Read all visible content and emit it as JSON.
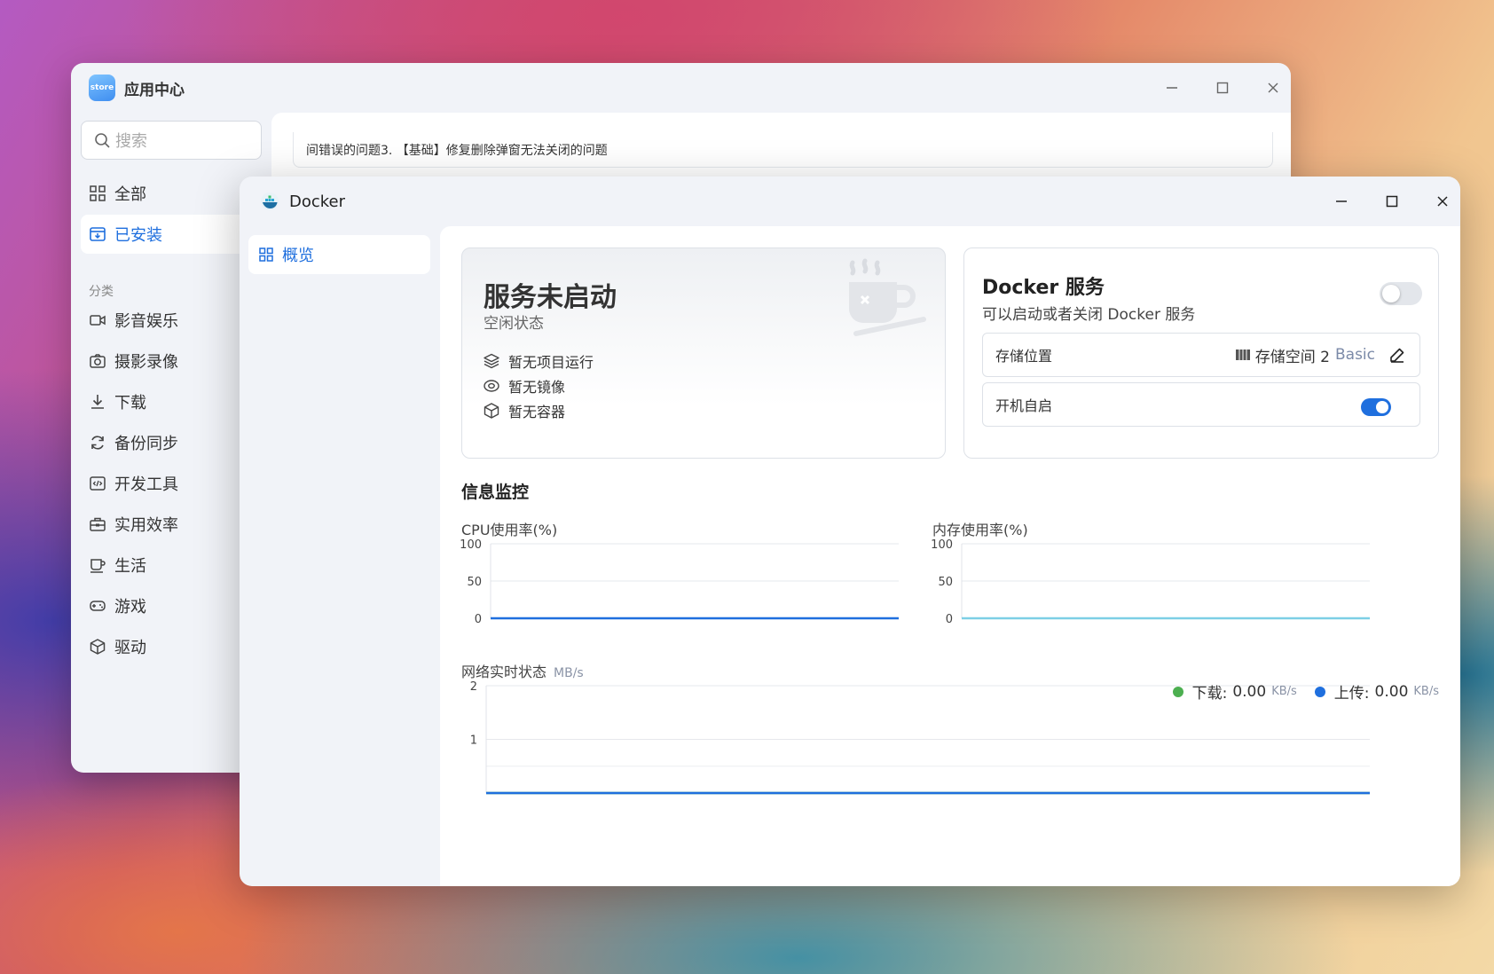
{
  "app_center": {
    "title": "应用中心",
    "search_placeholder": "搜索",
    "nav": [
      {
        "label": "全部",
        "icon": "grid-icon"
      },
      {
        "label": "已安装",
        "icon": "installed-icon",
        "active": true
      }
    ],
    "category_label": "分类",
    "categories": [
      {
        "label": "影音娱乐",
        "icon": "video-icon"
      },
      {
        "label": "摄影录像",
        "icon": "camera-icon"
      },
      {
        "label": "下载",
        "icon": "download-icon"
      },
      {
        "label": "备份同步",
        "icon": "sync-icon"
      },
      {
        "label": "开发工具",
        "icon": "code-icon"
      },
      {
        "label": "实用效率",
        "icon": "toolbox-icon"
      },
      {
        "label": "生活",
        "icon": "cup-icon"
      },
      {
        "label": "游戏",
        "icon": "gamepad-icon"
      },
      {
        "label": "驱动",
        "icon": "cube-icon"
      }
    ],
    "notice_text": "间错误的问题3. 【基础】修复删除弹窗无法关闭的问题"
  },
  "docker": {
    "title": "Docker",
    "sidebar": [
      {
        "label": "概览",
        "icon": "grid-icon"
      }
    ],
    "status": {
      "title": "服务未启动",
      "subtitle": "空闲状态",
      "items": [
        {
          "label": "暂无项目运行",
          "icon": "layers-icon"
        },
        {
          "label": "暂无镜像",
          "icon": "disc-icon"
        },
        {
          "label": "暂无容器",
          "icon": "box-icon"
        }
      ]
    },
    "service": {
      "title": "Docker 服务",
      "subtitle": "可以启动或者关闭 Docker 服务",
      "enabled": false,
      "storage_label": "存储位置",
      "storage_value": "存储空间 2",
      "storage_tag": "Basic",
      "autostart_label": "开机自启",
      "autostart": true
    },
    "monitor": {
      "title": "信息监控",
      "cpu_label": "CPU使用率(%)",
      "mem_label": "内存使用率(%)",
      "network_label": "网络实时状态",
      "network_unit": "MB/s",
      "download_label": "下载:",
      "download_value": "0.00",
      "upload_label": "上传:",
      "upload_value": "0.00",
      "rate_unit": "KB/s"
    }
  },
  "colors": {
    "accent": "#1f6fde",
    "download": "#4caf50",
    "upload": "#1f6fde",
    "mem_line": "#7dcfe6"
  },
  "chart_data": [
    {
      "type": "line",
      "title": "CPU使用率(%)",
      "ylim": [
        0,
        100
      ],
      "yticks": [
        0,
        50,
        100
      ],
      "series": [
        {
          "values": [
            0,
            0
          ]
        }
      ]
    },
    {
      "type": "line",
      "title": "内存使用率(%)",
      "ylim": [
        0,
        100
      ],
      "yticks": [
        0,
        50,
        100
      ],
      "series": [
        {
          "values": [
            0,
            0
          ]
        }
      ]
    },
    {
      "type": "line",
      "title": "网络实时状态",
      "ylabel": "MB/s",
      "ylim": [
        0,
        2
      ],
      "yticks": [
        1,
        2
      ],
      "series": [
        {
          "name": "下载",
          "values": [
            0,
            0
          ]
        },
        {
          "name": "上传",
          "values": [
            0,
            0
          ]
        }
      ]
    }
  ]
}
